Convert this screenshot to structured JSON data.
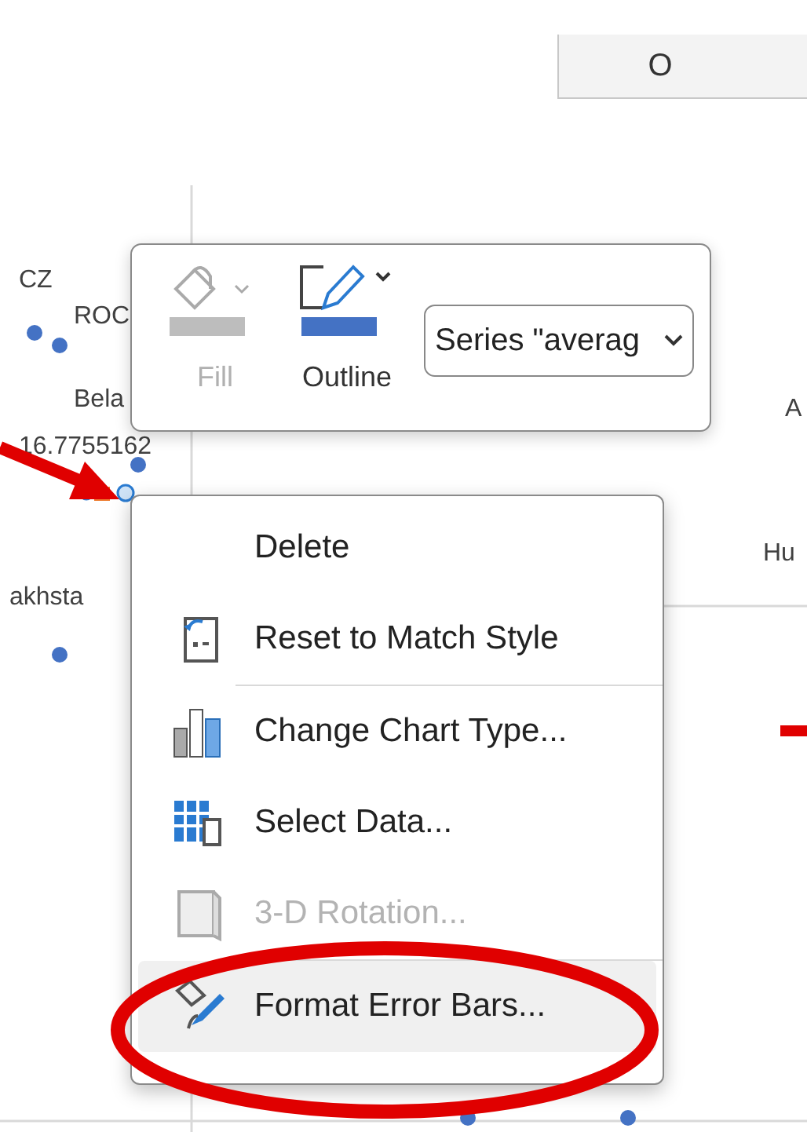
{
  "column_header": {
    "label": "O"
  },
  "chart_labels": [
    {
      "text": "CZ"
    },
    {
      "text": "ROC"
    },
    {
      "text": "Bela"
    },
    {
      "text": "16.7755162"
    },
    {
      "text": "akhsta"
    },
    {
      "text": "A"
    },
    {
      "text": "Hu"
    }
  ],
  "mini_toolbar": {
    "buttons": [
      {
        "kind": "fill",
        "label": "Fill",
        "disabled": true
      },
      {
        "kind": "outline",
        "label": "Outline",
        "disabled": false
      }
    ],
    "element_dropdown": {
      "value": "Series \"averag"
    }
  },
  "context_menu": {
    "items": [
      {
        "kind": "none",
        "label": "Delete",
        "disabled": false,
        "selected": false,
        "divider_before": false
      },
      {
        "kind": "reset",
        "label": "Reset to Match Style",
        "disabled": false,
        "selected": false,
        "divider_before": false
      },
      {
        "kind": "chart-type",
        "label": "Change Chart Type...",
        "disabled": false,
        "selected": false,
        "divider_before": true
      },
      {
        "kind": "select-data",
        "label": "Select Data...",
        "disabled": false,
        "selected": false,
        "divider_before": false
      },
      {
        "kind": "rotation",
        "label": "3-D Rotation...",
        "disabled": true,
        "selected": false,
        "divider_before": false
      },
      {
        "kind": "format",
        "label": "Format Error Bars...",
        "disabled": false,
        "selected": true,
        "divider_before": true
      }
    ]
  }
}
